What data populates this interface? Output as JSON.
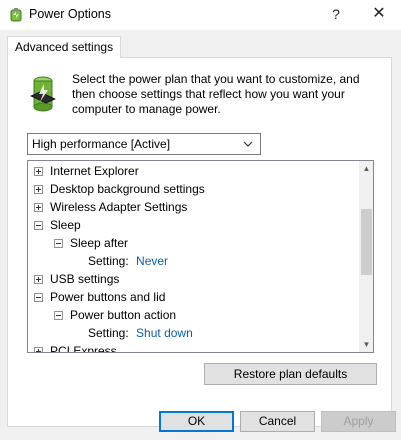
{
  "window": {
    "title": "Power Options",
    "help_glyph": "?",
    "close_glyph": "✕"
  },
  "tab": {
    "label": "Advanced settings"
  },
  "intro": {
    "line1": "Select the power plan that you want to customize, and",
    "line2": "then choose settings that reflect how you want your",
    "line3": "computer to manage power."
  },
  "plan_select": {
    "value": "High performance [Active]"
  },
  "tree": {
    "items": [
      {
        "label": "Internet Explorer"
      },
      {
        "label": "Desktop background settings"
      },
      {
        "label": "Wireless Adapter Settings"
      },
      {
        "label": "Sleep"
      },
      {
        "label": "Sleep after"
      },
      {
        "label": "Setting:",
        "value": "Never"
      },
      {
        "label": "USB settings"
      },
      {
        "label": "Power buttons and lid"
      },
      {
        "label": "Power button action"
      },
      {
        "label": "Setting:",
        "value": "Shut down"
      },
      {
        "label": "PCI Express"
      }
    ]
  },
  "buttons": {
    "restore": "Restore plan defaults",
    "ok": "OK",
    "cancel": "Cancel",
    "apply": "Apply"
  },
  "colors": {
    "accent": "#0078d7",
    "setting_value": "#0a5fb4"
  }
}
